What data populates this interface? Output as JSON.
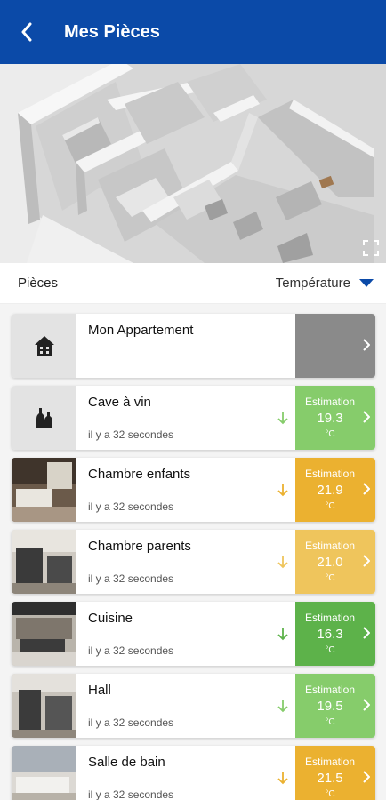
{
  "header": {
    "title": "Mes Pièces"
  },
  "filter": {
    "label": "Pièces",
    "sort_label": "Température"
  },
  "rooms": [
    {
      "name": "Mon Appartement",
      "icon": "house-icon",
      "time": "",
      "estimation": null,
      "color": "#8a8a8a"
    },
    {
      "name": "Cave à vin",
      "icon": "wine-bottles-icon",
      "time": "il y a 32 secondes",
      "estimation": {
        "label": "Estimation",
        "value": "19.3",
        "unit": "°C"
      },
      "color": "#86cc6b"
    },
    {
      "name": "Chambre enfants",
      "icon": "room-photo",
      "time": "il y a 32 secondes",
      "estimation": {
        "label": "Estimation",
        "value": "21.9",
        "unit": "°C"
      },
      "color": "#ebb130"
    },
    {
      "name": "Chambre parents",
      "icon": "room-photo",
      "time": "il y a 32 secondes",
      "estimation": {
        "label": "Estimation",
        "value": "21.0",
        "unit": "°C"
      },
      "color": "#efc55c"
    },
    {
      "name": "Cuisine",
      "icon": "room-photo",
      "time": "il y a 32 secondes",
      "estimation": {
        "label": "Estimation",
        "value": "16.3",
        "unit": "°C"
      },
      "color": "#5db24a"
    },
    {
      "name": "Hall",
      "icon": "room-photo",
      "time": "il y a 32 secondes",
      "estimation": {
        "label": "Estimation",
        "value": "19.5",
        "unit": "°C"
      },
      "color": "#86cc6b"
    },
    {
      "name": "Salle de bain",
      "icon": "room-photo",
      "time": "il y a 32 secondes",
      "estimation": {
        "label": "Estimation",
        "value": "21.5",
        "unit": "°C"
      },
      "color": "#ebb130"
    }
  ]
}
